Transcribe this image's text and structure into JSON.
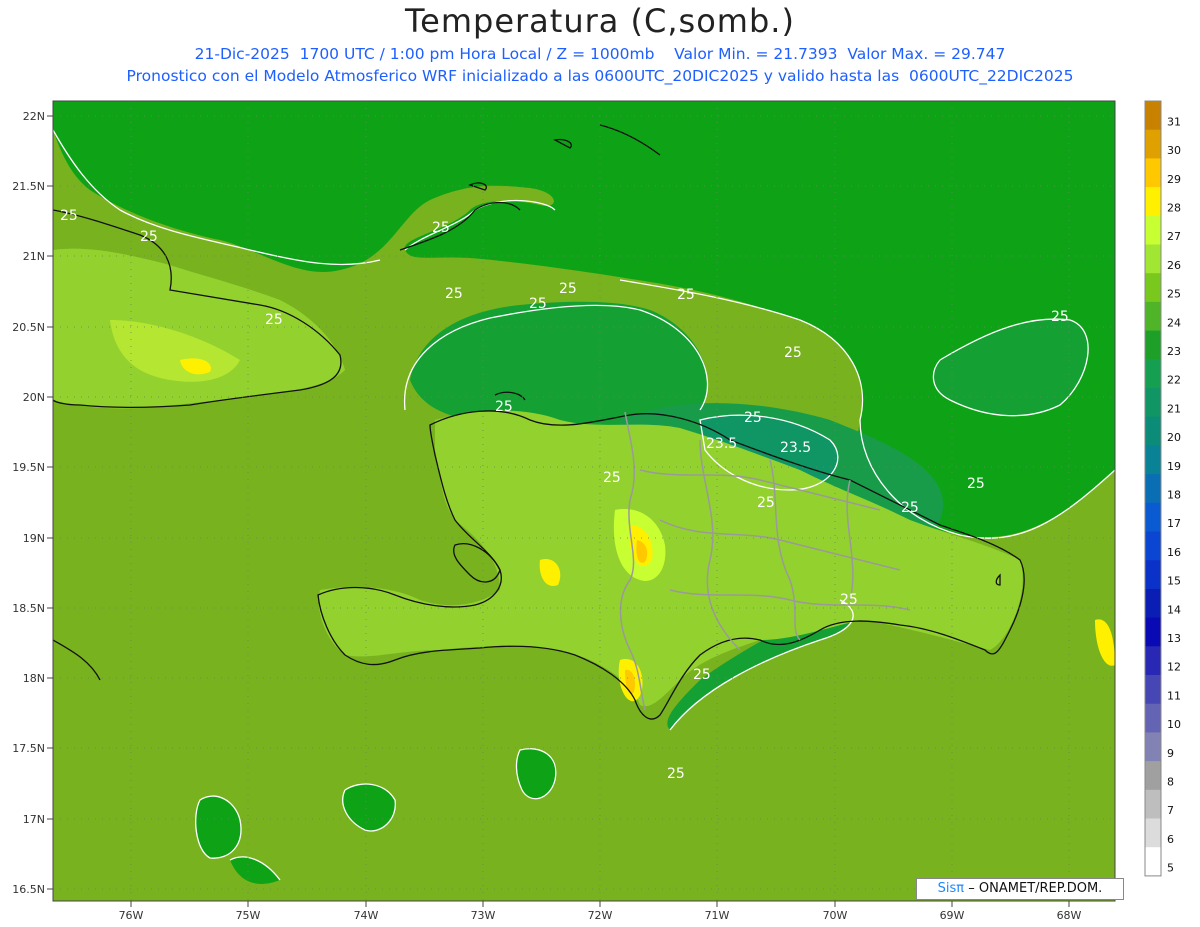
{
  "header": {
    "title": "Temperatura (C,somb.)",
    "line1": "21-Dic-2025  1700 UTC / 1:00 pm Hora Local / Z = 1000mb    Valor Min. = 21.7393  Valor Max. = 29.747",
    "line2": "Pronostico con el Modelo Atmosferico WRF inicializado a las 0600UTC_20DIC2025 y valido hasta las  0600UTC_22DIC2025"
  },
  "axes": {
    "lat_labels": [
      "22N",
      "21.5N",
      "21N",
      "20.5N",
      "20N",
      "19.5N",
      "19N",
      "18.5N",
      "18N",
      "17.5N",
      "17N",
      "16.5N"
    ],
    "lon_labels": [
      "76W",
      "75W",
      "74W",
      "73W",
      "72W",
      "71W",
      "70W",
      "69W",
      "68W"
    ]
  },
  "contour_labels": [
    "25",
    "25",
    "25",
    "25",
    "25",
    "25",
    "25",
    "25",
    "25",
    "23.5",
    "23.5",
    "25",
    "25",
    "25",
    "25",
    "25",
    "25",
    "25",
    "25",
    "25",
    "25"
  ],
  "colorbar": {
    "labels": [
      "31",
      "30",
      "29",
      "28",
      "27",
      "26",
      "25",
      "24",
      "23",
      "22",
      "21",
      "20",
      "19",
      "18",
      "17",
      "16",
      "15",
      "14",
      "13",
      "12",
      "11",
      "10",
      "9",
      "8",
      "7",
      "6",
      "5"
    ],
    "colors": [
      "#c88200",
      "#e0a000",
      "#ffc800",
      "#fff000",
      "#c8ff32",
      "#a0e632",
      "#78c81e",
      "#50b428",
      "#1ea028",
      "#14a050",
      "#0f9664",
      "#0a8c78",
      "#0a8296",
      "#0a6eb4",
      "#0a5ad2",
      "#0a46d2",
      "#0a32c8",
      "#0a1eb4",
      "#0a0ab4",
      "#2828b4",
      "#4646b4",
      "#6464b4",
      "#8282b4",
      "#a0a0a0",
      "#bebebe",
      "#dcdcdc",
      "#ffffff"
    ]
  },
  "credit": {
    "brand": "Sisπ",
    "text": "– ONAMET/REP.DOM."
  }
}
